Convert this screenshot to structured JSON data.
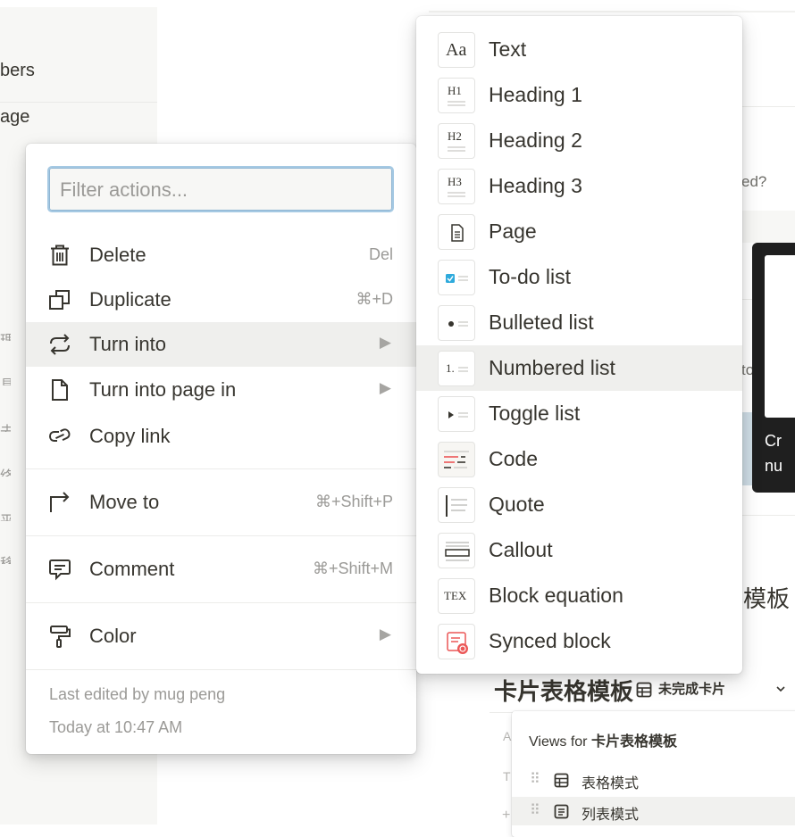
{
  "sidebar": {
    "text_members": "bers",
    "text_page": "age"
  },
  "background": {
    "fragment_ed": "ed?",
    "fragment_to": "to",
    "tooltip_line1": "Cr",
    "tooltip_line2": "nu",
    "heading_fragment": "模板",
    "database_title": "卡片表格模板",
    "database_view": "未完成卡片",
    "views_popup": {
      "title_prefix": "Views for ",
      "title_name": "卡片表格模板",
      "views": [
        "表格模式",
        "列表模式"
      ]
    },
    "left_letters": [
      "A",
      "T",
      "+"
    ]
  },
  "menu": {
    "filter_placeholder": "Filter actions...",
    "items": [
      {
        "label": "Delete",
        "shortcut": "Del",
        "icon": "trash-icon"
      },
      {
        "label": "Duplicate",
        "shortcut": "⌘+D",
        "icon": "duplicate-icon"
      },
      {
        "label": "Turn into",
        "shortcut": "",
        "icon": "turn-into-icon",
        "submenu": true,
        "highlighted": true
      },
      {
        "label": "Turn into page in",
        "shortcut": "",
        "icon": "page-icon",
        "submenu": true
      },
      {
        "label": "Copy link",
        "shortcut": "",
        "icon": "link-icon"
      },
      {
        "label": "Move to",
        "shortcut": "⌘+Shift+P",
        "icon": "move-arrow-icon"
      },
      {
        "label": "Comment",
        "shortcut": "⌘+Shift+M",
        "icon": "comment-icon"
      },
      {
        "label": "Color",
        "shortcut": "",
        "icon": "paint-roller-icon",
        "submenu": true
      }
    ],
    "last_edited_by": "Last edited by mug peng",
    "last_edited_time": "Today at 10:47 AM"
  },
  "submenu": {
    "items": [
      {
        "label": "Text",
        "icon": "text-block-icon",
        "icon_text": "Aa"
      },
      {
        "label": "Heading 1",
        "icon": "heading1-icon",
        "icon_text": "H1"
      },
      {
        "label": "Heading 2",
        "icon": "heading2-icon",
        "icon_text": "H2"
      },
      {
        "label": "Heading 3",
        "icon": "heading3-icon",
        "icon_text": "H3"
      },
      {
        "label": "Page",
        "icon": "page-doc-icon",
        "icon_text": ""
      },
      {
        "label": "To-do list",
        "icon": "todo-checkbox-icon",
        "icon_text": ""
      },
      {
        "label": "Bulleted list",
        "icon": "bullet-list-icon",
        "icon_text": ""
      },
      {
        "label": "Numbered list",
        "icon": "numbered-list-icon",
        "icon_text": "1.",
        "highlighted": true
      },
      {
        "label": "Toggle list",
        "icon": "toggle-list-icon",
        "icon_text": ""
      },
      {
        "label": "Code",
        "icon": "code-block-icon",
        "icon_text": ""
      },
      {
        "label": "Quote",
        "icon": "quote-icon",
        "icon_text": ""
      },
      {
        "label": "Callout",
        "icon": "callout-icon",
        "icon_text": ""
      },
      {
        "label": "Block equation",
        "icon": "tex-equation-icon",
        "icon_text": "TEX"
      },
      {
        "label": "Synced block",
        "icon": "synced-block-icon",
        "icon_text": ""
      }
    ]
  },
  "colors": {
    "highlight": "#efefed",
    "focus_border": "#a5c9e3",
    "todo_blue": "#2eaadc",
    "synced_red": "#eb5757"
  }
}
